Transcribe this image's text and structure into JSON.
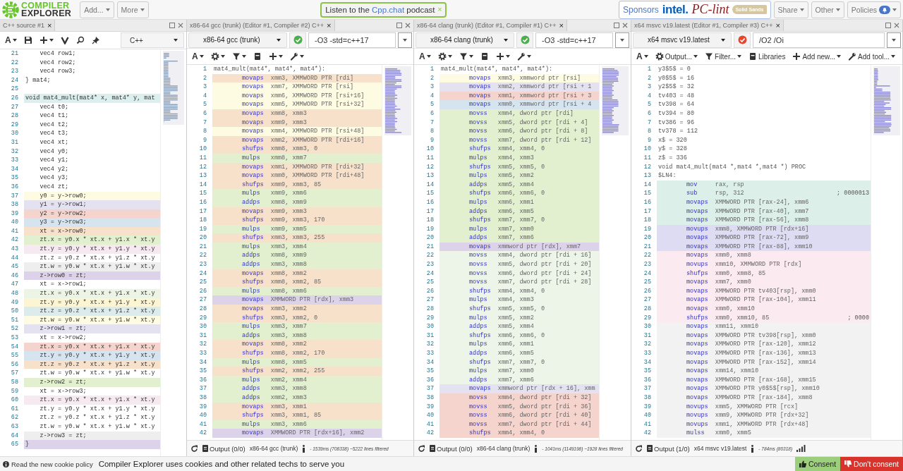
{
  "header": {
    "logo": [
      "COMPILER",
      "EXPLORER"
    ],
    "menus": [
      {
        "label": "Add..."
      },
      {
        "label": "More"
      }
    ],
    "announcement": {
      "before": "Listen to the ",
      "link": "Cpp.chat",
      "after": " podcast",
      "close": "×"
    },
    "sponsors": {
      "label": "Sponsors",
      "logos": [
        {
          "kind": "intel",
          "text": "intel."
        },
        {
          "kind": "pclint",
          "text": "PC-lint"
        },
        {
          "kind": "solid",
          "text": "Solid Sands"
        }
      ]
    },
    "buttons": [
      {
        "label": "Share",
        "has_notification": false
      },
      {
        "label": "Other",
        "has_notification": false
      },
      {
        "label": "Policies",
        "has_notification": true
      }
    ]
  },
  "source": {
    "tab": "C++ source #1",
    "close": "×",
    "language": "C++",
    "toolbar": [
      {
        "kind": "font",
        "glyph": "A",
        "dropdown": true
      },
      {
        "kind": "save",
        "dropdown": false
      },
      {
        "kind": "add",
        "dropdown": true
      },
      {
        "kind": "vim",
        "dropdown": false
      },
      {
        "kind": "search",
        "dropdown": false
      },
      {
        "kind": "pin",
        "dropdown": false
      }
    ],
    "lines": [
      {
        "n": "21",
        "code": "    vec4 row1;"
      },
      {
        "n": "22",
        "code": "    vec4 row2;"
      },
      {
        "n": "23",
        "code": "    vec4 row3;"
      },
      {
        "n": "24",
        "code": "} mat4;"
      },
      {
        "n": "25"
      },
      {
        "n": "26",
        "code": "void mat4_mult(mat4* x, mat4* y, mat",
        "color": "#dcefef"
      },
      {
        "n": "27",
        "code": "    vec4 t0;"
      },
      {
        "n": "28",
        "code": "    vec4 t1;"
      },
      {
        "n": "29",
        "code": "    vec4 t2;"
      },
      {
        "n": "30",
        "code": "    vec4 t3;"
      },
      {
        "n": "31",
        "code": "    vec4 xt;"
      },
      {
        "n": "32",
        "code": "    vec4 y0;"
      },
      {
        "n": "33",
        "code": "    vec4 y1;"
      },
      {
        "n": "34",
        "code": "    vec4 y2;"
      },
      {
        "n": "35",
        "code": "    vec4 y3;"
      },
      {
        "n": "36",
        "code": "    vec4 zt;"
      },
      {
        "n": "37",
        "code": "    y0 = y->row0;",
        "color": "#fdfbe1"
      },
      {
        "n": "38",
        "code": "    y1 = y->row1;",
        "color": "#e4e1f0"
      },
      {
        "n": "39",
        "code": "    y2 = y->row2;",
        "color": "#f4d4cc"
      },
      {
        "n": "40",
        "code": "    y3 = y->row3;",
        "color": "#d5e4ef"
      },
      {
        "n": "41",
        "code": "    xt = x->row0;",
        "color": "#f8e1cb"
      },
      {
        "n": "42",
        "code": "    zt.x = y0.x * xt.x + y1.x * xt.y",
        "color": "#e3f0cf"
      },
      {
        "n": "43",
        "code": "    zt.y = y0.y * xt.x + y1.y * xt.y",
        "color": "#f7e9f0"
      },
      {
        "n": "44",
        "code": "    zt.z = y0.z * xt.x + y1.z * xt.y"
      },
      {
        "n": "45",
        "code": "    zt.w = y0.w * xt.x + y1.w * xt.y",
        "color": "#eeeeee"
      },
      {
        "n": "46",
        "code": "    z->row0 = zt;",
        "color": "#dcd2ea"
      },
      {
        "n": "47",
        "code": "    xt = x->row1;"
      },
      {
        "n": "48",
        "code": "    zt.x = y0.x * xt.x + y1.x * xt.y",
        "color": "#ecf4e6"
      },
      {
        "n": "49",
        "code": "    zt.y = y0.y * xt.x + y1.y * xt.y",
        "color": "#fbf5d3"
      },
      {
        "n": "50",
        "code": "    zt.z = y0.z * xt.x + y1.z * xt.y",
        "color": "#dcecec"
      },
      {
        "n": "51",
        "code": "    zt.w = y0.w * xt.x + y1.w * xt.y",
        "color": "#fdfbe1"
      },
      {
        "n": "52",
        "code": "    z->row1 = zt;",
        "color": "#e4e1f0"
      },
      {
        "n": "53",
        "code": "    xt = x->row2;"
      },
      {
        "n": "54",
        "code": "    zt.x = y0.x * xt.x + y1.x * xt.y",
        "color": "#f4d4cc"
      },
      {
        "n": "55",
        "code": "    zt.y = y0.y * xt.x + y1.y * xt.y",
        "color": "#d5e4ef"
      },
      {
        "n": "56",
        "code": "    zt.z = y0.z * xt.x + y1.z * xt.y",
        "color": "#f8e1cb"
      },
      {
        "n": "57",
        "code": "    zt.w = y0.w * xt.x + y1.w * xt.y"
      },
      {
        "n": "58",
        "code": "    z->row2 = zt;",
        "color": "#e3f0cf"
      },
      {
        "n": "59",
        "code": "    xt = x->row3;"
      },
      {
        "n": "60",
        "code": "    zt.x = y0.x * xt.x + y1.x * xt.y",
        "color": "#f7e9f0"
      },
      {
        "n": "61",
        "code": "    zt.y = y0.y * xt.x + y1.y * xt.y"
      },
      {
        "n": "62",
        "code": "    zt.z = y0.z * xt.x + y1.z * xt.y"
      },
      {
        "n": "63",
        "code": "    zt.w = y0.w * xt.x + y1.w * xt.y"
      },
      {
        "n": "64",
        "code": "    z->row3 = zt;",
        "color": "#eeeeee"
      },
      {
        "n": "65",
        "code": "}",
        "color": "#dcd2ea"
      }
    ]
  },
  "compilers": [
    {
      "tab": "x86-64 gcc (trunk) (Editor #1, Compiler #2) C++",
      "close": "×",
      "compiler": "x86-64 gcc (trunk)",
      "failed": false,
      "options": "-O3 -std=c++17",
      "toolbar": [
        {
          "kind": "font",
          "glyph": "A",
          "dropdown": true
        },
        {
          "kind": "settings",
          "dropdown": true
        },
        {
          "kind": "filter",
          "dropdown": true
        },
        {
          "kind": "libraries",
          "dropdown": false
        },
        {
          "kind": "add",
          "dropdown": true
        },
        {
          "kind": "tool",
          "dropdown": true
        }
      ],
      "lines": [
        {
          "n": "1",
          "kind": "label",
          "text": "mat4_mult(mat4*, mat4*, mat4*):"
        },
        {
          "n": "2",
          "kind": "instr",
          "op": "movaps",
          "args": "xmm3, XMMWORD PTR [rdi]",
          "color": "#f8e1cb"
        },
        {
          "n": "3",
          "kind": "instr",
          "op": "movaps",
          "args": "xmm7, XMMWORD PTR [rsi]",
          "color": "#fdfbe1"
        },
        {
          "n": "4",
          "kind": "instr",
          "op": "movaps",
          "args": "xmm6, XMMWORD PTR [rsi+16]",
          "color": "#fdfbe1"
        },
        {
          "n": "5",
          "kind": "instr",
          "op": "movaps",
          "args": "xmm5, XMMWORD PTR [rsi+32]",
          "color": "#fdfbe1"
        },
        {
          "n": "6",
          "kind": "instr",
          "op": "movaps",
          "args": "xmm8, xmm3",
          "color": "#f8e1cb"
        },
        {
          "n": "7",
          "kind": "instr",
          "op": "movaps",
          "args": "xmm9, xmm3",
          "color": "#f8e1cb"
        },
        {
          "n": "8",
          "kind": "instr",
          "op": "movaps",
          "args": "xmm4, XMMWORD PTR [rsi+48]",
          "color": "#fdfbe1"
        },
        {
          "n": "9",
          "kind": "instr",
          "op": "movaps",
          "args": "xmm2, XMMWORD PTR [rdi+16]",
          "color": "#f8e1cb"
        },
        {
          "n": "10",
          "kind": "instr",
          "op": "shufps",
          "args": "xmm8, xmm3, 0",
          "color": "#f8e1cb"
        },
        {
          "n": "11",
          "kind": "instr",
          "op": "mulps",
          "args": "xmm8, xmm7",
          "color": "#e3f0cf"
        },
        {
          "n": "12",
          "kind": "instr",
          "op": "movaps",
          "args": "xmm1, XMMWORD PTR [rdi+32]",
          "color": "#f8e1cb"
        },
        {
          "n": "13",
          "kind": "instr",
          "op": "movaps",
          "args": "xmm0, XMMWORD PTR [rdi+48]",
          "color": "#f8e1cb"
        },
        {
          "n": "14",
          "kind": "instr",
          "op": "shufps",
          "args": "xmm9, xmm3, 85",
          "color": "#f8e1cb"
        },
        {
          "n": "15",
          "kind": "instr",
          "op": "mulps",
          "args": "xmm9, xmm6",
          "color": "#e3f0cf"
        },
        {
          "n": "16",
          "kind": "instr",
          "op": "addps",
          "args": "xmm8, xmm9",
          "color": "#e3f0cf"
        },
        {
          "n": "17",
          "kind": "instr",
          "op": "movaps",
          "args": "xmm9, xmm3",
          "color": "#f8e1cb"
        },
        {
          "n": "18",
          "kind": "instr",
          "op": "shufps",
          "args": "xmm9, xmm3, 170",
          "color": "#f8e1cb"
        },
        {
          "n": "19",
          "kind": "instr",
          "op": "mulps",
          "args": "xmm9, xmm5",
          "color": "#e3f0cf"
        },
        {
          "n": "20",
          "kind": "instr",
          "op": "shufps",
          "args": "xmm3, xmm3, 255",
          "color": "#f8e1cb"
        },
        {
          "n": "21",
          "kind": "instr",
          "op": "mulps",
          "args": "xmm3, xmm4",
          "color": "#e3f0cf"
        },
        {
          "n": "22",
          "kind": "instr",
          "op": "addps",
          "args": "xmm8, xmm9",
          "color": "#e3f0cf"
        },
        {
          "n": "23",
          "kind": "instr",
          "op": "addps",
          "args": "xmm3, xmm8",
          "color": "#e3f0cf"
        },
        {
          "n": "24",
          "kind": "instr",
          "op": "movaps",
          "args": "xmm8, xmm2",
          "color": "#f8e1cb"
        },
        {
          "n": "25",
          "kind": "instr",
          "op": "shufps",
          "args": "xmm8, xmm2, 85",
          "color": "#f8e1cb"
        },
        {
          "n": "26",
          "kind": "instr",
          "op": "mulps",
          "args": "xmm8, xmm6",
          "color": "#e3f0cf"
        },
        {
          "n": "27",
          "kind": "instr",
          "op": "movaps",
          "args": "XMMWORD PTR [rdx], xmm3",
          "color": "#dcd2ea"
        },
        {
          "n": "28",
          "kind": "instr",
          "op": "movaps",
          "args": "xmm3, xmm2",
          "color": "#f8e1cb"
        },
        {
          "n": "29",
          "kind": "instr",
          "op": "shufps",
          "args": "xmm3, xmm2, 0",
          "color": "#f8e1cb"
        },
        {
          "n": "30",
          "kind": "instr",
          "op": "mulps",
          "args": "xmm3, xmm7",
          "color": "#e3f0cf"
        },
        {
          "n": "31",
          "kind": "instr",
          "op": "addps",
          "args": "xmm3, xmm8",
          "color": "#e3f0cf"
        },
        {
          "n": "32",
          "kind": "instr",
          "op": "movaps",
          "args": "xmm8, xmm2",
          "color": "#f8e1cb"
        },
        {
          "n": "33",
          "kind": "instr",
          "op": "shufps",
          "args": "xmm8, xmm2, 170",
          "color": "#f8e1cb"
        },
        {
          "n": "34",
          "kind": "instr",
          "op": "mulps",
          "args": "xmm8, xmm5",
          "color": "#e3f0cf"
        },
        {
          "n": "35",
          "kind": "instr",
          "op": "shufps",
          "args": "xmm2, xmm2, 255",
          "color": "#f8e1cb"
        },
        {
          "n": "36",
          "kind": "instr",
          "op": "mulps",
          "args": "xmm2, xmm4",
          "color": "#e3f0cf"
        },
        {
          "n": "37",
          "kind": "instr",
          "op": "addps",
          "args": "xmm3, xmm8",
          "color": "#e3f0cf"
        },
        {
          "n": "38",
          "kind": "instr",
          "op": "addps",
          "args": "xmm2, xmm3",
          "color": "#e3f0cf"
        },
        {
          "n": "39",
          "kind": "instr",
          "op": "movaps",
          "args": "xmm3, xmm1",
          "color": "#f8e1cb"
        },
        {
          "n": "40",
          "kind": "instr",
          "op": "shufps",
          "args": "xmm3, xmm1, 85",
          "color": "#f8e1cb"
        },
        {
          "n": "41",
          "kind": "instr",
          "op": "mulps",
          "args": "xmm3, xmm6",
          "color": "#e3f0cf"
        },
        {
          "n": "42",
          "kind": "instr",
          "op": "movaps",
          "args": "XMMWORD PTR [rdx+16], xmm2",
          "color": "#dcd2ea"
        }
      ],
      "footer": {
        "output": "Output",
        "counts": "(0/0)",
        "compiler": "x86-64 gcc (trunk)",
        "stats": "- 1539ms (708338) ~5222 lines filtered",
        "graph_button": false
      }
    },
    {
      "tab": "x86-64 clang (trunk) (Editor #1, Compiler #1) C++",
      "close": "×",
      "compiler": "x86-64 clang (trunk)",
      "failed": false,
      "options": "-O3 -std=c++17",
      "toolbar": [
        {
          "kind": "font",
          "glyph": "A",
          "dropdown": true
        },
        {
          "kind": "settings",
          "dropdown": true
        },
        {
          "kind": "filter",
          "dropdown": true
        },
        {
          "kind": "libraries",
          "dropdown": false
        },
        {
          "kind": "add",
          "dropdown": true
        },
        {
          "kind": "tool",
          "dropdown": true
        }
      ],
      "lines": [
        {
          "n": "1",
          "kind": "label",
          "text": "mat4_mult(mat4*, mat4*, mat4*):"
        },
        {
          "n": "2",
          "kind": "instr",
          "op": "movaps",
          "args": "xmm3, xmmword ptr [rsi]",
          "color": "#fdfbe1"
        },
        {
          "n": "3",
          "kind": "instr",
          "op": "movaps",
          "args": "xmm2, xmmword ptr [rsi + 1",
          "color": "#e4e1f0"
        },
        {
          "n": "4",
          "kind": "instr",
          "op": "movaps",
          "args": "xmm1, xmmword ptr [rsi + 3",
          "color": "#f4d4cc"
        },
        {
          "n": "5",
          "kind": "instr",
          "op": "movaps",
          "args": "xmm0, xmmword ptr [rsi + 4",
          "color": "#d5e4ef"
        },
        {
          "n": "6",
          "kind": "instr",
          "op": "movss",
          "args": "xmm4, dword ptr [rdi]",
          "color": "#e3f0cf"
        },
        {
          "n": "7",
          "kind": "instr",
          "op": "movss",
          "args": "xmm5, dword ptr [rdi + 4]",
          "color": "#e3f0cf"
        },
        {
          "n": "8",
          "kind": "instr",
          "op": "movss",
          "args": "xmm6, dword ptr [rdi + 8]",
          "color": "#e3f0cf"
        },
        {
          "n": "9",
          "kind": "instr",
          "op": "movss",
          "args": "xmm7, dword ptr [rdi + 12]",
          "color": "#e3f0cf"
        },
        {
          "n": "10",
          "kind": "instr",
          "op": "shufps",
          "args": "xmm4, xmm4, 0",
          "color": "#e3f0cf"
        },
        {
          "n": "11",
          "kind": "instr",
          "op": "mulps",
          "args": "xmm4, xmm3",
          "color": "#e3f0cf"
        },
        {
          "n": "12",
          "kind": "instr",
          "op": "shufps",
          "args": "xmm5, xmm5, 0",
          "color": "#e3f0cf"
        },
        {
          "n": "13",
          "kind": "instr",
          "op": "mulps",
          "args": "xmm5, xmm2",
          "color": "#e3f0cf"
        },
        {
          "n": "14",
          "kind": "instr",
          "op": "addps",
          "args": "xmm5, xmm4",
          "color": "#e3f0cf"
        },
        {
          "n": "15",
          "kind": "instr",
          "op": "shufps",
          "args": "xmm6, xmm6, 0",
          "color": "#e3f0cf"
        },
        {
          "n": "16",
          "kind": "instr",
          "op": "mulps",
          "args": "xmm6, xmm1",
          "color": "#e3f0cf"
        },
        {
          "n": "17",
          "kind": "instr",
          "op": "addps",
          "args": "xmm6, xmm5",
          "color": "#e3f0cf"
        },
        {
          "n": "18",
          "kind": "instr",
          "op": "shufps",
          "args": "xmm7, xmm7, 0",
          "color": "#e3f0cf"
        },
        {
          "n": "19",
          "kind": "instr",
          "op": "mulps",
          "args": "xmm7, xmm0",
          "color": "#e3f0cf"
        },
        {
          "n": "20",
          "kind": "instr",
          "op": "addps",
          "args": "xmm7, xmm6",
          "color": "#e3f0cf"
        },
        {
          "n": "21",
          "kind": "instr",
          "op": "movaps",
          "args": "xmmword ptr [rdx], xmm7",
          "color": "#dcd2ea"
        },
        {
          "n": "22",
          "kind": "instr",
          "op": "movss",
          "args": "xmm4, dword ptr [rdi + 16]",
          "color": "#edf5e9"
        },
        {
          "n": "23",
          "kind": "instr",
          "op": "movss",
          "args": "xmm5, dword ptr [rdi + 20]",
          "color": "#edf5e9"
        },
        {
          "n": "24",
          "kind": "instr",
          "op": "movss",
          "args": "xmm6, dword ptr [rdi + 24]",
          "color": "#edf5e9"
        },
        {
          "n": "25",
          "kind": "instr",
          "op": "movss",
          "args": "xmm7, dword ptr [rdi + 28]",
          "color": "#edf5e9"
        },
        {
          "n": "26",
          "kind": "instr",
          "op": "shufps",
          "args": "xmm4, xmm4, 0",
          "color": "#edf5e9"
        },
        {
          "n": "27",
          "kind": "instr",
          "op": "mulps",
          "args": "xmm4, xmm3",
          "color": "#edf5e9"
        },
        {
          "n": "28",
          "kind": "instr",
          "op": "shufps",
          "args": "xmm5, xmm5, 0",
          "color": "#edf5e9"
        },
        {
          "n": "29",
          "kind": "instr",
          "op": "mulps",
          "args": "xmm5, xmm2",
          "color": "#edf5e9"
        },
        {
          "n": "30",
          "kind": "instr",
          "op": "addps",
          "args": "xmm5, xmm4",
          "color": "#edf5e9"
        },
        {
          "n": "31",
          "kind": "instr",
          "op": "shufps",
          "args": "xmm6, xmm6, 0",
          "color": "#edf5e9"
        },
        {
          "n": "32",
          "kind": "instr",
          "op": "mulps",
          "args": "xmm6, xmm1",
          "color": "#edf5e9"
        },
        {
          "n": "33",
          "kind": "instr",
          "op": "addps",
          "args": "xmm6, xmm5",
          "color": "#edf5e9"
        },
        {
          "n": "34",
          "kind": "instr",
          "op": "shufps",
          "args": "xmm7, xmm7, 0",
          "color": "#edf5e9"
        },
        {
          "n": "35",
          "kind": "instr",
          "op": "mulps",
          "args": "xmm7, xmm0",
          "color": "#edf5e9"
        },
        {
          "n": "36",
          "kind": "instr",
          "op": "addps",
          "args": "xmm7, xmm6",
          "color": "#edf5e9"
        },
        {
          "n": "37",
          "kind": "instr",
          "op": "movaps",
          "args": "xmmword ptr [rdx + 16], xmm",
          "color": "#e4e1f0"
        },
        {
          "n": "38",
          "kind": "instr",
          "op": "movss",
          "args": "xmm4, dword ptr [rdi + 32]",
          "color": "#f4d4cc"
        },
        {
          "n": "39",
          "kind": "instr",
          "op": "movss",
          "args": "xmm5, dword ptr [rdi + 36]",
          "color": "#f4d4cc"
        },
        {
          "n": "40",
          "kind": "instr",
          "op": "movss",
          "args": "xmm6, dword ptr [rdi + 40]",
          "color": "#f4d4cc"
        },
        {
          "n": "41",
          "kind": "instr",
          "op": "movss",
          "args": "xmm7, dword ptr [rdi + 44]",
          "color": "#f4d4cc"
        },
        {
          "n": "42",
          "kind": "instr",
          "op": "shufps",
          "args": "xmm4, xmm4, 0",
          "color": "#f4d4cc"
        }
      ],
      "footer": {
        "output": "Output",
        "counts": "(0/0)",
        "compiler": "x86-64 clang (trunk)",
        "stats": "- 1041ms (1149198) ~1928 lines filtered",
        "graph_button": false
      }
    },
    {
      "tab": "x64 msvc v19.latest (Editor #1, Compiler #3) C++",
      "close": "×",
      "compiler": "x64 msvc v19.latest",
      "failed": true,
      "options": "/O2 /Oi",
      "toolbar": [
        {
          "kind": "font",
          "glyph": "A",
          "dropdown": true
        },
        {
          "kind": "settings",
          "label": "Output...",
          "dropdown": true
        },
        {
          "kind": "filter",
          "label": "Filter...",
          "dropdown": true
        },
        {
          "kind": "libraries",
          "label": "Libraries",
          "dropdown": false
        },
        {
          "kind": "add",
          "label": "Add new...",
          "dropdown": true
        },
        {
          "kind": "tool",
          "label": "Add tool...",
          "dropdown": true
        }
      ],
      "lines": [
        {
          "n": "1",
          "kind": "label",
          "text": "y3$5$ = 0"
        },
        {
          "n": "2",
          "kind": "label",
          "text": "y0$5$ = 16"
        },
        {
          "n": "3",
          "kind": "label",
          "text": "y2$5$ = 32"
        },
        {
          "n": "4",
          "kind": "label",
          "text": "tv403 = 48"
        },
        {
          "n": "5",
          "kind": "label",
          "text": "tv398 = 64"
        },
        {
          "n": "6",
          "kind": "label",
          "text": "tv394 = 80"
        },
        {
          "n": "7",
          "kind": "label",
          "text": "tv386 = 96"
        },
        {
          "n": "8",
          "kind": "label",
          "text": "tv378 = 112"
        },
        {
          "n": "9",
          "kind": "label",
          "text": "x$ = 320"
        },
        {
          "n": "10",
          "kind": "label",
          "text": "y$ = 328"
        },
        {
          "n": "11",
          "kind": "label",
          "text": "z$ = 336"
        },
        {
          "n": "12",
          "kind": "label",
          "text": "void mat4_mult(mat4 *,mat4 *,mat4 *) PROC"
        },
        {
          "n": "13",
          "kind": "label",
          "text": "$LN4:"
        },
        {
          "n": "14",
          "kind": "instr",
          "op": "mov",
          "args": "rax, rsp",
          "color": "#dcefe8"
        },
        {
          "n": "15",
          "kind": "instr",
          "op": "sub",
          "args": "rsp, 312",
          "comment": "; 0000013",
          "color": "#dcefe8"
        },
        {
          "n": "16",
          "kind": "instr",
          "op": "movaps",
          "args": "XMMWORD PTR [rax-24], xmm6",
          "color": "#dcefe8"
        },
        {
          "n": "17",
          "kind": "instr",
          "op": "movaps",
          "args": "XMMWORD PTR [rax-40], xmm7",
          "color": "#dcefe8"
        },
        {
          "n": "18",
          "kind": "instr",
          "op": "movaps",
          "args": "XMMWORD PTR [rax-56], xmm8",
          "color": "#dcefe8"
        },
        {
          "n": "19",
          "kind": "instr",
          "op": "movups",
          "args": "xmm8, XMMWORD PTR [rdx+16]",
          "color": "#dedcf2"
        },
        {
          "n": "20",
          "kind": "instr",
          "op": "movaps",
          "args": "XMMWORD PTR [rax-72], xmm9",
          "color": "#dedcf2"
        },
        {
          "n": "21",
          "kind": "instr",
          "op": "movaps",
          "args": "XMMWORD PTR [rax-88], xmm10",
          "color": "#dedcf2"
        },
        {
          "n": "22",
          "kind": "instr",
          "op": "movaps",
          "args": "xmm0, xmm8",
          "color": "#fbeaf0"
        },
        {
          "n": "23",
          "kind": "instr",
          "op": "movups",
          "args": "xmm10, XMMWORD PTR [rdx]",
          "color": "#fbeaf0"
        },
        {
          "n": "24",
          "kind": "instr",
          "op": "shufps",
          "args": "xmm0, xmm8, 85",
          "color": "#fbeaf0"
        },
        {
          "n": "25",
          "kind": "instr",
          "op": "movaps",
          "args": "xmm7, xmm0",
          "color": "#fbeaf0"
        },
        {
          "n": "26",
          "kind": "instr",
          "op": "movaps",
          "args": "XMMWORD PTR tv403[rsp], xmm0",
          "color": "#fbeaf0"
        },
        {
          "n": "27",
          "kind": "instr",
          "op": "movaps",
          "args": "XMMWORD PTR [rax-104], xmm11",
          "color": "#fbeaf0"
        },
        {
          "n": "28",
          "kind": "instr",
          "op": "movaps",
          "args": "xmm0, xmm10",
          "color": "#fbeaf0"
        },
        {
          "n": "29",
          "kind": "instr",
          "op": "shufps",
          "args": "xmm0, xmm10, 85",
          "comment": "; 0000",
          "color": "#fbeaf0"
        },
        {
          "n": "30",
          "kind": "instr",
          "op": "movaps",
          "args": "xmm11, xmm10",
          "color": "#f2f2f2"
        },
        {
          "n": "31",
          "kind": "instr",
          "op": "movaps",
          "args": "XMMWORD PTR tv398[rsp], xmm0",
          "color": "#f2f2f2"
        },
        {
          "n": "32",
          "kind": "instr",
          "op": "movaps",
          "args": "XMMWORD PTR [rax-120], xmm12",
          "color": "#f2f2f2"
        },
        {
          "n": "33",
          "kind": "instr",
          "op": "movaps",
          "args": "XMMWORD PTR [rax-136], xmm13",
          "color": "#f2f2f2"
        },
        {
          "n": "34",
          "kind": "instr",
          "op": "movaps",
          "args": "XMMWORD PTR [rax-152], xmm14",
          "color": "#f2f2f2"
        },
        {
          "n": "35",
          "kind": "instr",
          "op": "movaps",
          "args": "xmm14, xmm10",
          "color": "#f2f2f2"
        },
        {
          "n": "36",
          "kind": "instr",
          "op": "movaps",
          "args": "XMMWORD PTR [rax-168], xmm15",
          "color": "#f2f2f2"
        },
        {
          "n": "37",
          "kind": "instr",
          "op": "movaps",
          "args": "XMMWORD PTR y0$5$[rsp], xmm10",
          "color": "#f2f2f2"
        },
        {
          "n": "38",
          "kind": "instr",
          "op": "movaps",
          "args": "XMMWORD PTR [rax-184], xmm8",
          "color": "#f2f2f2"
        },
        {
          "n": "39",
          "kind": "instr",
          "op": "movups",
          "args": "xmm5, XMMWORD PTR [rcx]",
          "color": "#f2f2f2"
        },
        {
          "n": "40",
          "kind": "instr",
          "op": "movups",
          "args": "xmm9, XMMWORD PTR [rdx+32]",
          "color": "#f2f2f2"
        },
        {
          "n": "41",
          "kind": "instr",
          "op": "movups",
          "args": "xmm1, XMMWORD PTR [rdx+48]",
          "color": "#f2f2f2"
        },
        {
          "n": "42",
          "kind": "instr",
          "op": "mulss",
          "args": "xmm0, xmm5",
          "color": "#f2f2f2"
        }
      ],
      "footer": {
        "output": "Output",
        "counts": "(1/0)",
        "compiler": "x64 msvc v19.latest",
        "stats": "- 784ms (80318)",
        "graph_button": true
      }
    }
  ],
  "cookie_bar": {
    "policy_link": "Read the new cookie policy",
    "message": "Compiler Explorer uses cookies and other related techs to serve you",
    "buttons": [
      {
        "kind": "accept",
        "label": "Consent"
      },
      {
        "kind": "decline",
        "label": "Don't consent"
      }
    ]
  }
}
